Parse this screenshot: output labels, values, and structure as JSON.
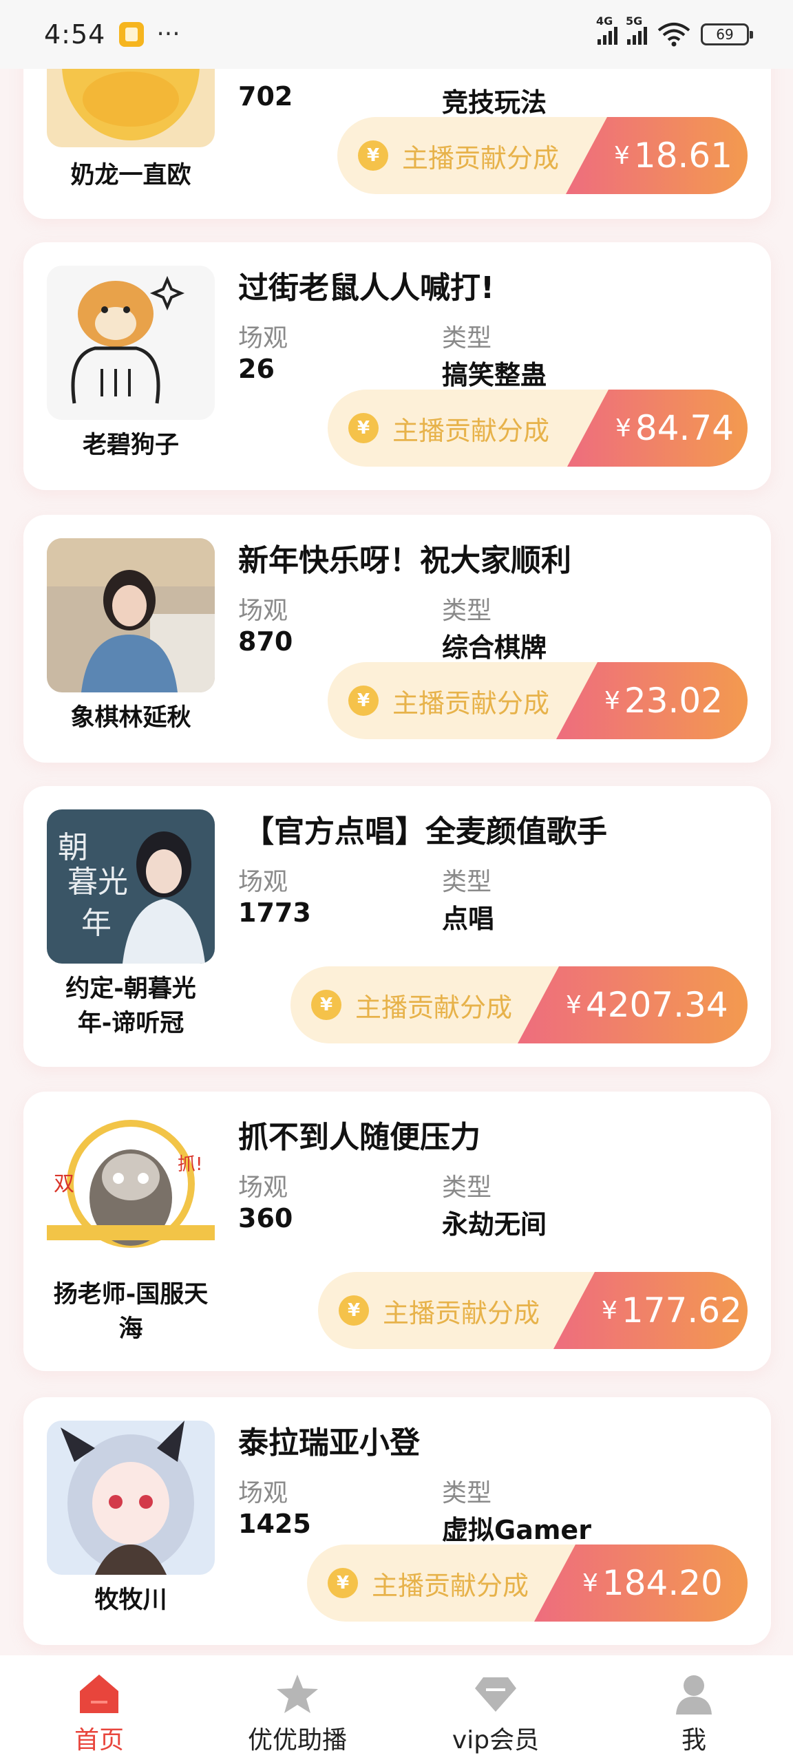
{
  "status_bar": {
    "time": "4:54",
    "dots": "···",
    "net1": "4G",
    "net2": "5G",
    "battery": "69"
  },
  "common": {
    "label_views": "场观",
    "label_type": "类型",
    "earn_label": "主播贡献分成",
    "currency": "¥"
  },
  "cards": [
    {
      "host": "奶龙一直欧",
      "title": "",
      "views": "702",
      "type": "竞技玩法",
      "amount": "18.61"
    },
    {
      "host": "老碧狗子",
      "title": "过街老鼠人人喊打!",
      "views": "26",
      "type": "搞笑整蛊",
      "amount": "84.74"
    },
    {
      "host": "象棋林延秋",
      "title": "新年快乐呀！祝大家顺利",
      "views": "870",
      "type": "综合棋牌",
      "amount": "23.02"
    },
    {
      "host_line1": "约定-朝暮光",
      "host_line2": "年-谛听冠",
      "title": "【官方点唱】全麦颜值歌手",
      "views": "1773",
      "type": "点唱",
      "amount": "4207.34",
      "avatar_text": "朝暮光年"
    },
    {
      "host_line1": "扬老师-国服天",
      "host_line2": "海",
      "title": "抓不到人随便压力",
      "views": "360",
      "type": "永劫无间",
      "amount": "177.62",
      "avatar_text_left": "双",
      "avatar_text_right": "抓!"
    },
    {
      "host": "牧牧川",
      "title": "泰拉瑞亚小登",
      "views": "1425",
      "type": "虚拟Gamer",
      "amount": "184.20"
    }
  ],
  "nav": [
    {
      "label": "首页",
      "icon": "home-icon",
      "active": true
    },
    {
      "label": "优优助播",
      "icon": "star-icon",
      "active": false
    },
    {
      "label": "vip会员",
      "icon": "diamond-icon",
      "active": false
    },
    {
      "label": "我",
      "icon": "user-icon",
      "active": false
    }
  ],
  "colors": {
    "accent": "#e8453c",
    "earn_gradient_start": "#ee6d7e",
    "earn_gradient_end": "#f39a4f",
    "earn_bg": "#fdf0d8",
    "earn_text": "#e7b24a"
  }
}
